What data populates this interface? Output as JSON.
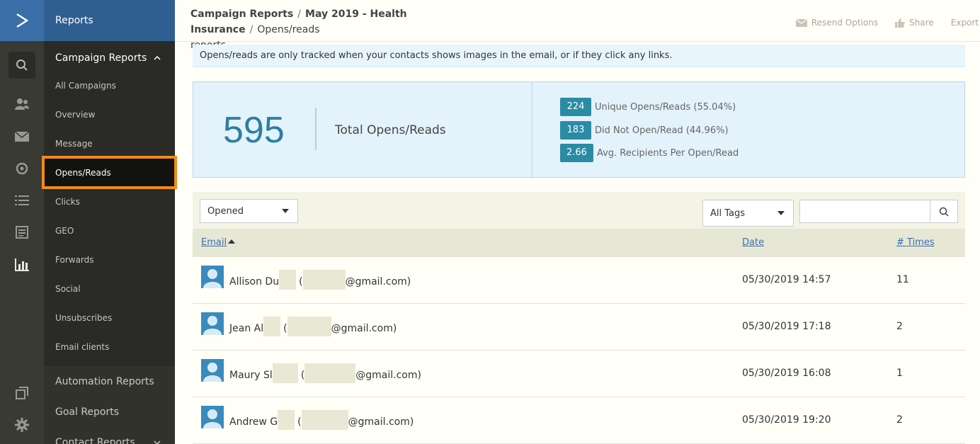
{
  "nav": {
    "app_section": "Reports",
    "campaign_reports": "Campaign Reports",
    "items": [
      {
        "label": "All Campaigns"
      },
      {
        "label": "Overview"
      },
      {
        "label": "Message"
      },
      {
        "label": "Opens/Reads"
      },
      {
        "label": "Clicks"
      },
      {
        "label": "GEO"
      },
      {
        "label": "Forwards"
      },
      {
        "label": "Social"
      },
      {
        "label": "Unsubscribes"
      },
      {
        "label": "Email clients"
      }
    ],
    "groups": [
      {
        "label": "Automation Reports"
      },
      {
        "label": "Goal Reports"
      },
      {
        "label": "Contact Reports"
      }
    ]
  },
  "header": {
    "crumb1": "Campaign Reports",
    "crumb2": "May 2019 - Health Insurance",
    "crumb3": "Opens/reads",
    "crumb3_cont": "reports",
    "actions": {
      "resend": "Resend Options",
      "share": "Share",
      "export": "Export"
    }
  },
  "notice": "Opens/reads are only tracked when your contacts shows images in the email, or if they click any links.",
  "stats": {
    "total": "595",
    "total_label": "Total Opens/Reads",
    "rows": [
      {
        "value": "224",
        "label": "Unique Opens/Reads (55.04%)"
      },
      {
        "value": "183",
        "label": "Did Not Open/Read (44.96%)"
      },
      {
        "value": "2.66",
        "label": "Avg. Recipients Per Open/Read"
      }
    ]
  },
  "filters": {
    "status": "Opened",
    "tags": "All Tags"
  },
  "table": {
    "headers": {
      "email": "Email",
      "date": "Date",
      "times": "# Times"
    },
    "rows": [
      {
        "name": "Allison Du",
        "paren": "(",
        "domain": "@gmail.com)",
        "date": "05/30/2019 14:57",
        "times": "11"
      },
      {
        "name": "Jean Al",
        "paren": "(",
        "domain": "@gmail.com)",
        "date": "05/30/2019 17:18",
        "times": "2"
      },
      {
        "name": "Maury Sl",
        "paren": "(",
        "domain": "@gmail.com)",
        "date": "05/30/2019 16:08",
        "times": "1"
      },
      {
        "name": "Andrew G",
        "paren": "(",
        "domain": "@gmail.com)",
        "date": "05/30/2019 19:20",
        "times": "2"
      }
    ]
  },
  "colors": {
    "brand_blue": "#3a6fa8",
    "teal": "#2a8ba5",
    "highlight": "#f28b18"
  }
}
